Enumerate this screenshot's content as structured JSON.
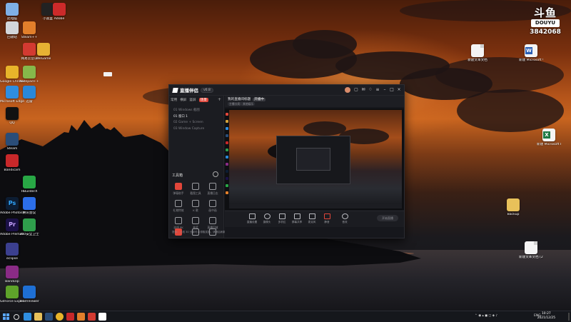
{
  "watermark": {
    "brand_top": "斗鱼",
    "brand_bottom": "DOUYU",
    "room_id": "3842068"
  },
  "desktop_icons": [
    {
      "label": "此电脑",
      "kind": "pc",
      "color": "#7fb0e6"
    },
    {
      "label": "回收站",
      "kind": "bin",
      "color": "#d3d6da"
    },
    {
      "label": "Google Chrome",
      "kind": "app",
      "color": "#e8b42a"
    },
    {
      "label": "Microsoft Edge",
      "kind": "app",
      "color": "#2f8ee0"
    },
    {
      "label": "QQ",
      "kind": "app",
      "color": "#111111"
    },
    {
      "label": "Steam",
      "kind": "app",
      "color": "#2a4d78"
    },
    {
      "label": "Bandicam",
      "kind": "app",
      "color": "#c7282a"
    },
    {
      "label": "Adobe Photoshop",
      "kind": "ps",
      "color": "#0c1d33"
    },
    {
      "label": "Adobe Premiere",
      "kind": "pr",
      "color": "#1b1147"
    },
    {
      "label": "eclipse",
      "kind": "app",
      "color": "#3b3f8f"
    },
    {
      "label": "Bandizip",
      "kind": "app",
      "color": "#8a2b86"
    },
    {
      "label": "GeForce Experience",
      "kind": "app",
      "color": "#5ea22a"
    },
    {
      "label": "网易云音乐",
      "kind": "app",
      "color": "#d33a31"
    },
    {
      "label": "Notepad++",
      "kind": "app",
      "color": "#86b84a"
    },
    {
      "label": "迅雷",
      "kind": "app",
      "color": "#2a88d9"
    },
    {
      "label": "腾讯会议",
      "kind": "app",
      "color": "#2c6ee8"
    },
    {
      "label": "360安全卫士",
      "kind": "app",
      "color": "#2f9e4c"
    },
    {
      "label": "TeamViewer",
      "kind": "app",
      "color": "#1e6fd4"
    },
    {
      "label": "Steam++",
      "kind": "app",
      "color": "#e27f2b"
    },
    {
      "label": "HBuilderX",
      "kind": "app",
      "color": "#28a745"
    },
    {
      "label": "WeGame",
      "kind": "app",
      "color": "#e6b233"
    },
    {
      "label": "小黑盒",
      "kind": "app",
      "color": "#222222"
    },
    {
      "label": "Adobe",
      "kind": "app",
      "color": "#cc2a2a"
    },
    {
      "label": "新建文本文档",
      "kind": "doc",
      "color": "#f4f4f4"
    },
    {
      "label": "新建 Microsoft Word 文档",
      "kind": "word",
      "color": "#2b5fb4"
    },
    {
      "label": "新建 Microsoft Excel 工作表",
      "kind": "excel",
      "color": "#1f7a45"
    },
    {
      "label": "Backup",
      "kind": "folder",
      "color": "#e8c15a"
    },
    {
      "label": "新建文本文档 (2)",
      "kind": "doc",
      "color": "#f4f4f4"
    }
  ],
  "app": {
    "name": "直播伴侣",
    "version": "v6.8",
    "left_tabs": [
      "常用",
      "横屏",
      "竖屏",
      "场景"
    ],
    "scenes": [
      "01 Windows 截图",
      "01 窗口 1",
      "02 Game + Screen",
      "03 Window Capture"
    ],
    "section_title": "工具箱",
    "tools": [
      "弹幕助手",
      "截图工具",
      "直播日志",
      "礼物特效",
      "K 歌",
      "画中画",
      "连线 PK",
      "抽奖",
      "直播回放",
      "音乐",
      "美颜",
      "更多"
    ],
    "live_title": "我的直播间标题",
    "live_badge": "开播中",
    "live_sub": "主播分类：其他娱乐",
    "controls": [
      "直播设置",
      "摄像头",
      "多机位",
      "屏幕共享",
      "麦克风",
      "静音",
      "音效"
    ],
    "go_live": "开始直播",
    "notice": "提示：上线 30 分钟可以领取奖励，请稍后刷新"
  },
  "taskbar": {
    "tray_text": "ENG",
    "time": "10:27",
    "date": "2021/12/25"
  }
}
